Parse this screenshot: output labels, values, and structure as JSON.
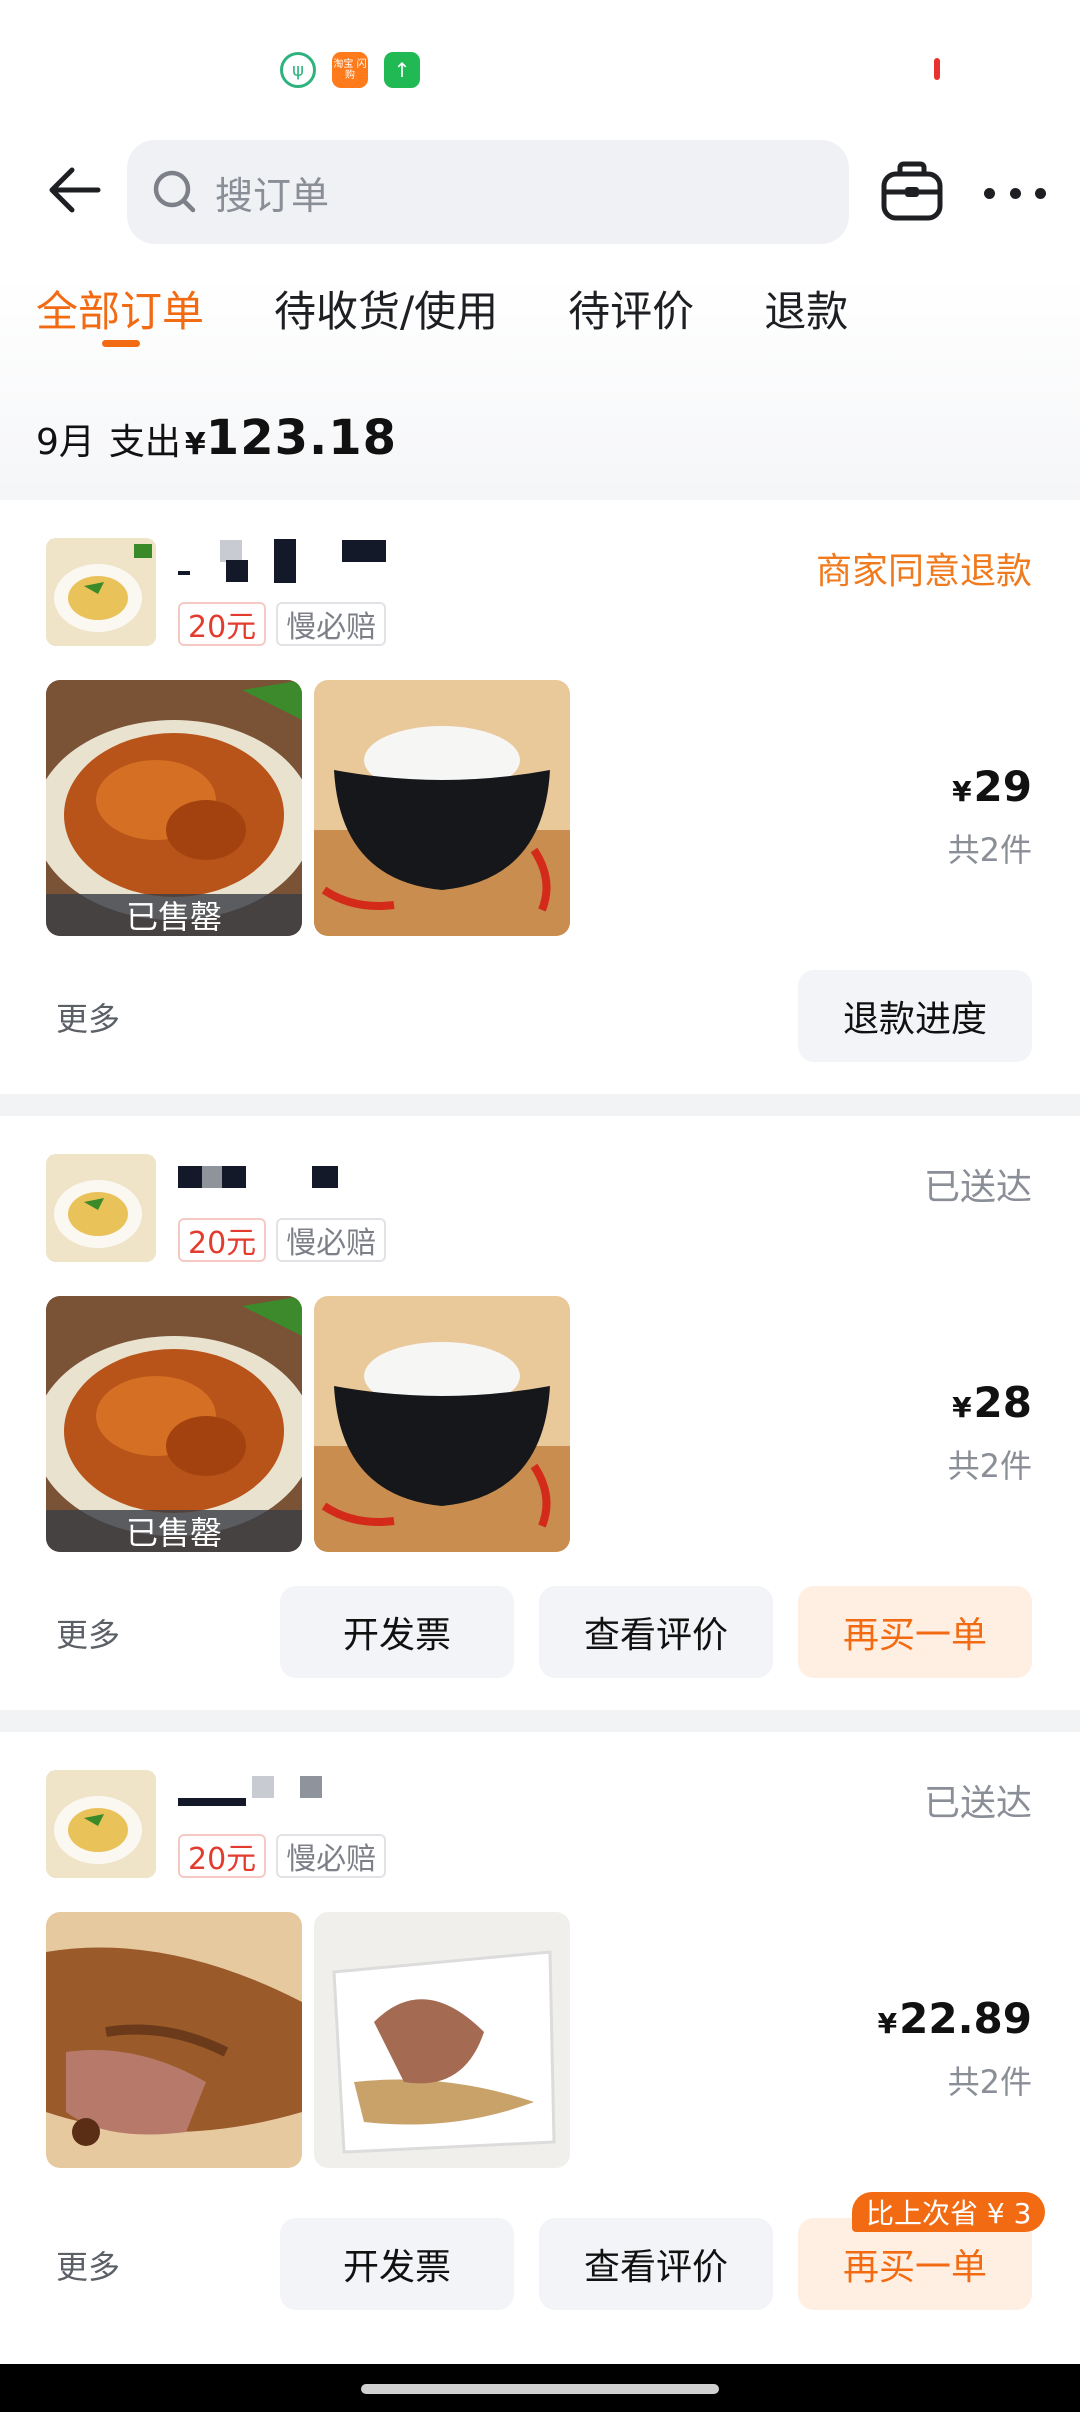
{
  "status_bar": {
    "icons": [
      "leaf-app-icon",
      "taobao-shangou-icon",
      "upload-app-icon"
    ],
    "taobao_label": "淘宝\n闪购"
  },
  "header": {
    "search_placeholder": "搜订单",
    "back_icon": "arrow-left-icon",
    "bag_icon": "briefcase-icon",
    "more_icon": "more-dots-icon"
  },
  "tabs": [
    {
      "label": "全部订单",
      "active": true
    },
    {
      "label": "待收货/使用",
      "active": false
    },
    {
      "label": "待评价",
      "active": false
    },
    {
      "label": "退款",
      "active": false
    }
  ],
  "summary": {
    "month": "9月",
    "label": "支出",
    "currency": "¥",
    "amount": "123.18"
  },
  "orders": [
    {
      "status": "商家同意退款",
      "tags": [
        "20元",
        "慢必赔"
      ],
      "sold_out_label": "已售罄",
      "currency": "¥",
      "price": "29",
      "count": "共2件",
      "more": "更多",
      "buttons": [
        "退款进度"
      ]
    },
    {
      "status": "已送达",
      "tags": [
        "20元",
        "慢必赔"
      ],
      "sold_out_label": "已售罄",
      "currency": "¥",
      "price": "28",
      "count": "共2件",
      "more": "更多",
      "buttons": [
        "开发票",
        "查看评价",
        "再买一单"
      ]
    },
    {
      "status": "已送达",
      "tags": [
        "20元",
        "慢必赔"
      ],
      "currency": "¥",
      "price": "22.89",
      "count": "共2件",
      "more": "更多",
      "buttons": [
        "开发票",
        "查看评价",
        "再买一单"
      ],
      "badge": "比上次省 ¥ 3"
    }
  ],
  "colors": {
    "accent": "#f26b13",
    "status_orange": "#f07a1e",
    "tag_red": "#e43b2f",
    "button_bg": "#f2f4f7",
    "button_orange_bg": "#ffeee2"
  }
}
